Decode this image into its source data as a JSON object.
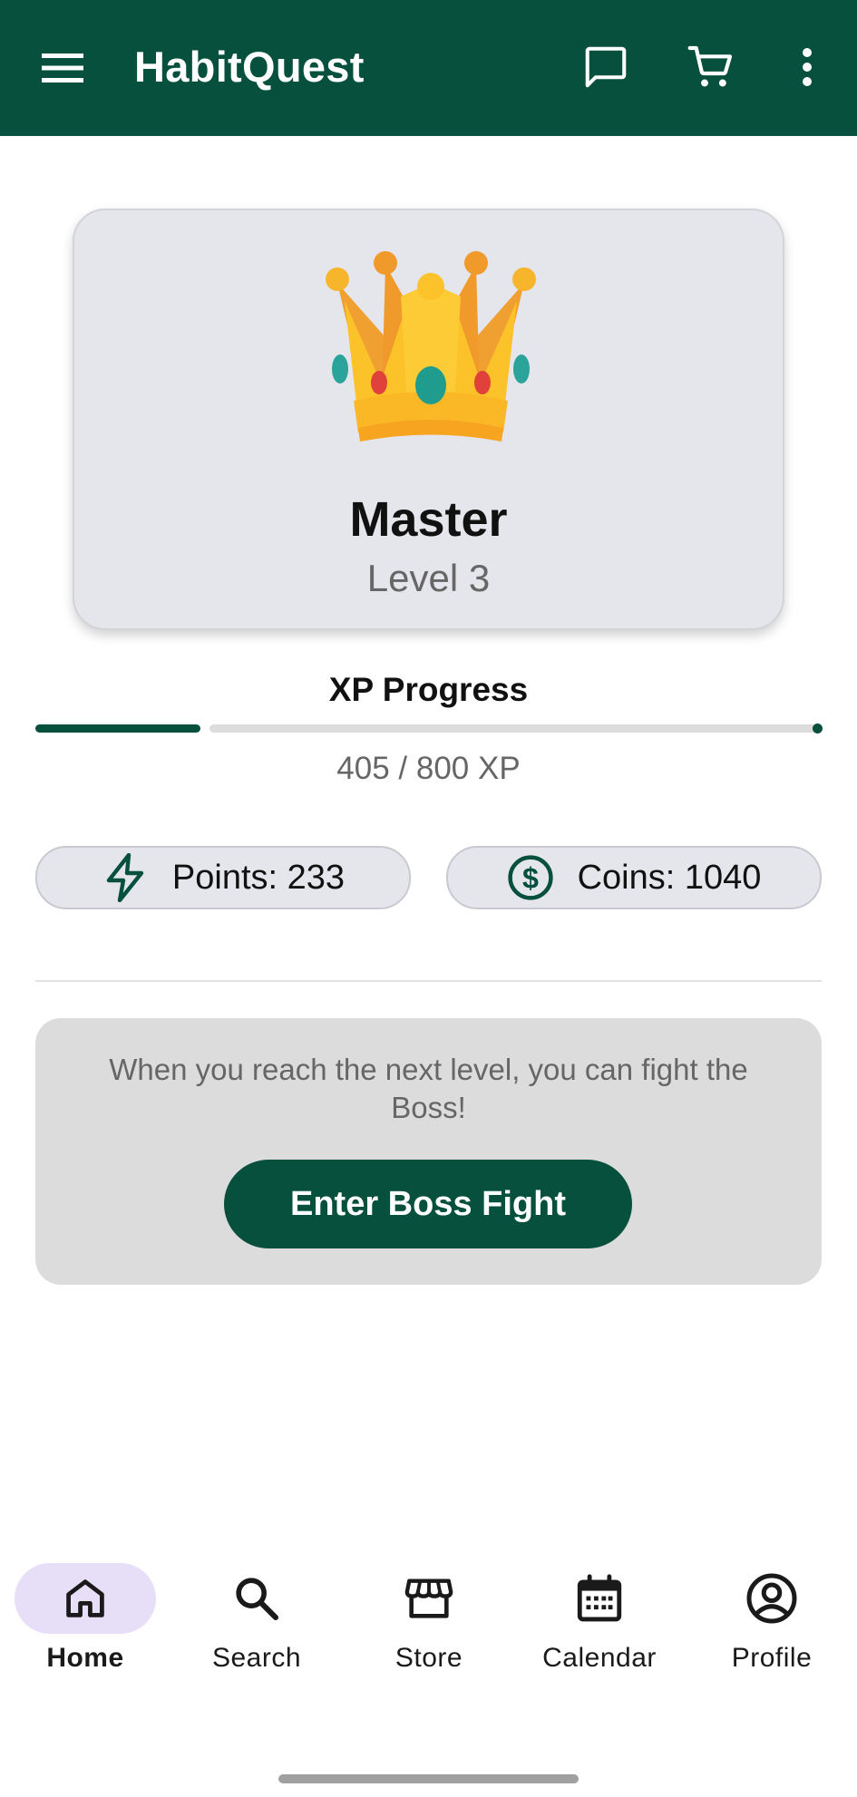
{
  "app_bar": {
    "title": "HabitQuest",
    "menu_icon": "menu-icon",
    "actions": [
      "chat-icon",
      "cart-icon",
      "more-vert-icon"
    ],
    "color": "#07503d"
  },
  "rank_card": {
    "emoji_icon": "crown-icon",
    "rank": "Master",
    "level": "Level 3"
  },
  "xp": {
    "label": "XP Progress",
    "text": "405 / 800 XP",
    "current": 405,
    "max": 800
  },
  "stats": {
    "points": {
      "label": "Points: 233",
      "icon": "lightning-icon"
    },
    "coins": {
      "label": "Coins: 1040",
      "icon": "dollar-coin-icon"
    }
  },
  "boss": {
    "message": "When you reach the next level, you can fight the Boss!",
    "button_label": "Enter Boss Fight"
  },
  "bottom_nav": {
    "items": [
      {
        "label": "Home",
        "icon": "home-icon",
        "active": true
      },
      {
        "label": "Search",
        "icon": "search-icon",
        "active": false
      },
      {
        "label": "Store",
        "icon": "store-icon",
        "active": false
      },
      {
        "label": "Calendar",
        "icon": "calendar-icon",
        "active": false
      },
      {
        "label": "Profile",
        "icon": "profile-icon",
        "active": false
      }
    ]
  }
}
